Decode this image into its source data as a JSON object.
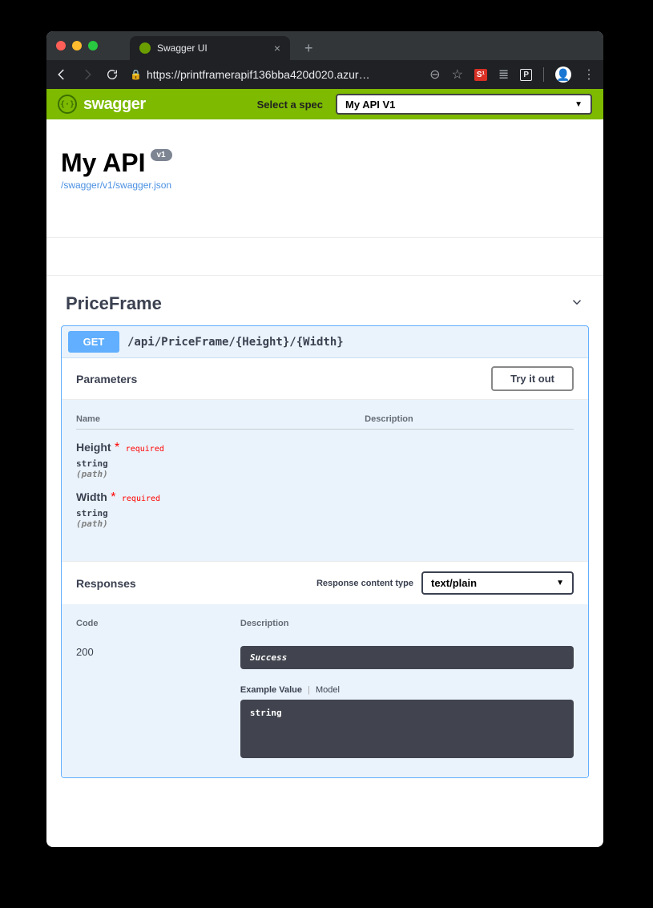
{
  "browser": {
    "tab_title": "Swagger UI",
    "url_display": "https://printframerapif136bba420d020.azur…"
  },
  "topbar": {
    "brand": "swagger",
    "spec_label": "Select a spec",
    "spec_selected": "My API V1"
  },
  "api": {
    "title": "My API",
    "version_badge": "v1",
    "json_link": "/swagger/v1/swagger.json"
  },
  "tag": {
    "name": "PriceFrame"
  },
  "operation": {
    "method": "GET",
    "path": "/api/PriceFrame/{Height}/{Width}",
    "parameters_heading": "Parameters",
    "tryout_label": "Try it out",
    "table_headers": {
      "name": "Name",
      "description": "Description"
    },
    "params": [
      {
        "name": "Height",
        "required_label": "required",
        "type": "string",
        "location": "(path)"
      },
      {
        "name": "Width",
        "required_label": "required",
        "type": "string",
        "location": "(path)"
      }
    ],
    "responses_heading": "Responses",
    "content_type_label": "Response content type",
    "content_type_value": "text/plain",
    "response_headers": {
      "code": "Code",
      "description": "Description"
    },
    "responses": [
      {
        "code": "200",
        "description": "Success",
        "example_label": "Example Value",
        "model_label": "Model",
        "example_body": "string"
      }
    ]
  }
}
